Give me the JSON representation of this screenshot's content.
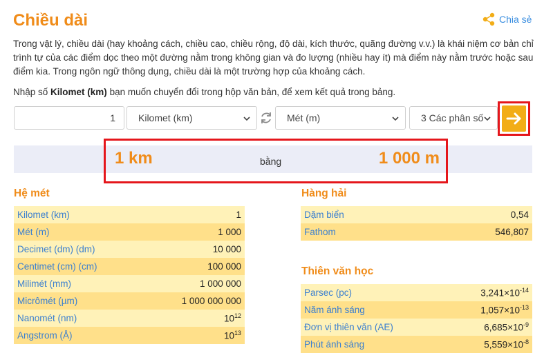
{
  "page": {
    "title": "Chiều dài",
    "share_label": "Chia sẻ",
    "description": "Trong vật lý, chiều dài (hay khoảng cách, chiều cao, chiều rộng, độ dài, kích thước, quãng đường v.v.) là khái niệm cơ bản chỉ trình tự của các điểm dọc theo một đường nằm trong không gian và đo lượng (nhiều hay ít) mà điểm này nằm trước hoặc sau điểm kia. Trong ngôn ngữ thông dụng, chiều dài là một trường hợp của khoảng cách.",
    "instruction_prefix": "Nhập số ",
    "instruction_unit": "Kilomet (km)",
    "instruction_suffix": " bạn muốn chuyển đổi trong hộp văn bản, để xem kết quả trong bảng."
  },
  "converter": {
    "input_value": "1",
    "from_unit": "Kilomet (km)",
    "to_unit": "Mét (m)",
    "precision": "3 Các phân số",
    "swap_icon": "swap-arrows-icon",
    "go_icon": "arrow-right-icon"
  },
  "result": {
    "from": "1 km",
    "equals": "bằng",
    "to": "1 000 m"
  },
  "colors": {
    "accent_orange": "#f08c1a",
    "go_button": "#f2ad17",
    "highlight_red": "#e5161b",
    "link_blue": "#3a7fd0",
    "row_light": "#fff2b8",
    "row_dark": "#ffe08a",
    "result_band": "#ebedf7"
  },
  "metric": {
    "title": "Hệ mét",
    "rows": [
      {
        "unit": "Kilomet (km)",
        "value": "1"
      },
      {
        "unit": "Mét (m)",
        "value": "1 000"
      },
      {
        "unit": "Decimet (dm) (dm)",
        "value": "10 000"
      },
      {
        "unit": "Centimet (cm) (cm)",
        "value": "100 000"
      },
      {
        "unit": "Milimét (mm)",
        "value": "1 000 000"
      },
      {
        "unit": "Micrômét (µm)",
        "value": "1 000 000 000"
      },
      {
        "unit": "Nanomét (nm)",
        "value": "10",
        "exp": "12"
      },
      {
        "unit": "Angstrom (Å)",
        "value": "10",
        "exp": "13"
      }
    ]
  },
  "nautical": {
    "title": "Hàng hải",
    "rows": [
      {
        "unit": "Dặm biển",
        "value": "0,54"
      },
      {
        "unit": "Fathom",
        "value": "546,807"
      }
    ]
  },
  "astronomy": {
    "title": "Thiên văn học",
    "rows": [
      {
        "unit": "Parsec (pc)",
        "value": "3,241×10",
        "exp": "-14"
      },
      {
        "unit": "Năm ánh sáng",
        "value": "1,057×10",
        "exp": "-13"
      },
      {
        "unit": "Đơn vị thiên văn (AE)",
        "value": "6,685×10",
        "exp": "-9"
      },
      {
        "unit": "Phút ánh sáng",
        "value": "5,559×10",
        "exp": "-8"
      }
    ]
  }
}
